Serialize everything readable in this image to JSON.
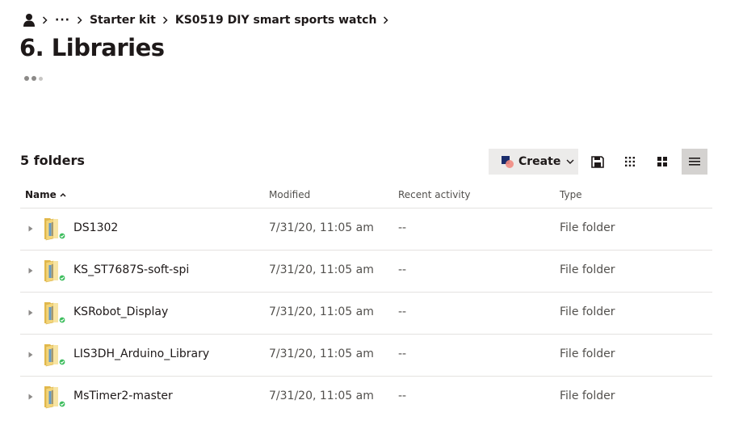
{
  "breadcrumb": {
    "icon": "user-icon",
    "more": "···",
    "items": [
      "Starter kit",
      "KS0519 DIY smart sports watch"
    ]
  },
  "page": {
    "title": "6. Libraries"
  },
  "summary": {
    "folder_count": "5 folders"
  },
  "toolbar": {
    "create_label": "Create",
    "icons": [
      "save-offline-icon",
      "grid-small-icon",
      "grid-large-icon",
      "list-view-icon"
    ],
    "active_view": "list-view-icon"
  },
  "table": {
    "columns": {
      "name": "Name",
      "modified": "Modified",
      "activity": "Recent activity",
      "type": "Type"
    },
    "sort": "name-ascending",
    "rows": [
      {
        "name": "DS1302",
        "modified": "7/31/20, 11:05 am",
        "activity": "--",
        "type": "File folder",
        "synced": true
      },
      {
        "name": "KS_ST7687S-soft-spi",
        "modified": "7/31/20, 11:05 am",
        "activity": "--",
        "type": "File folder",
        "synced": true
      },
      {
        "name": "KSRobot_Display",
        "modified": "7/31/20, 11:05 am",
        "activity": "--",
        "type": "File folder",
        "synced": true
      },
      {
        "name": "LIS3DH_Arduino_Library",
        "modified": "7/31/20, 11:05 am",
        "activity": "--",
        "type": "File folder",
        "synced": true
      },
      {
        "name": "MsTimer2-master",
        "modified": "7/31/20, 11:05 am",
        "activity": "--",
        "type": "File folder",
        "synced": true
      }
    ]
  },
  "colors": {
    "text": "#1e1919",
    "muted": "#52504d",
    "divider": "#e4e2e0",
    "button_bg": "#ecebea",
    "active_view_bg": "#d4d2d0",
    "folder": "#f3d57a",
    "synced_badge": "#3dbd5d",
    "brand_square": "#1a2c6b",
    "brand_circle": "#f28b82"
  }
}
